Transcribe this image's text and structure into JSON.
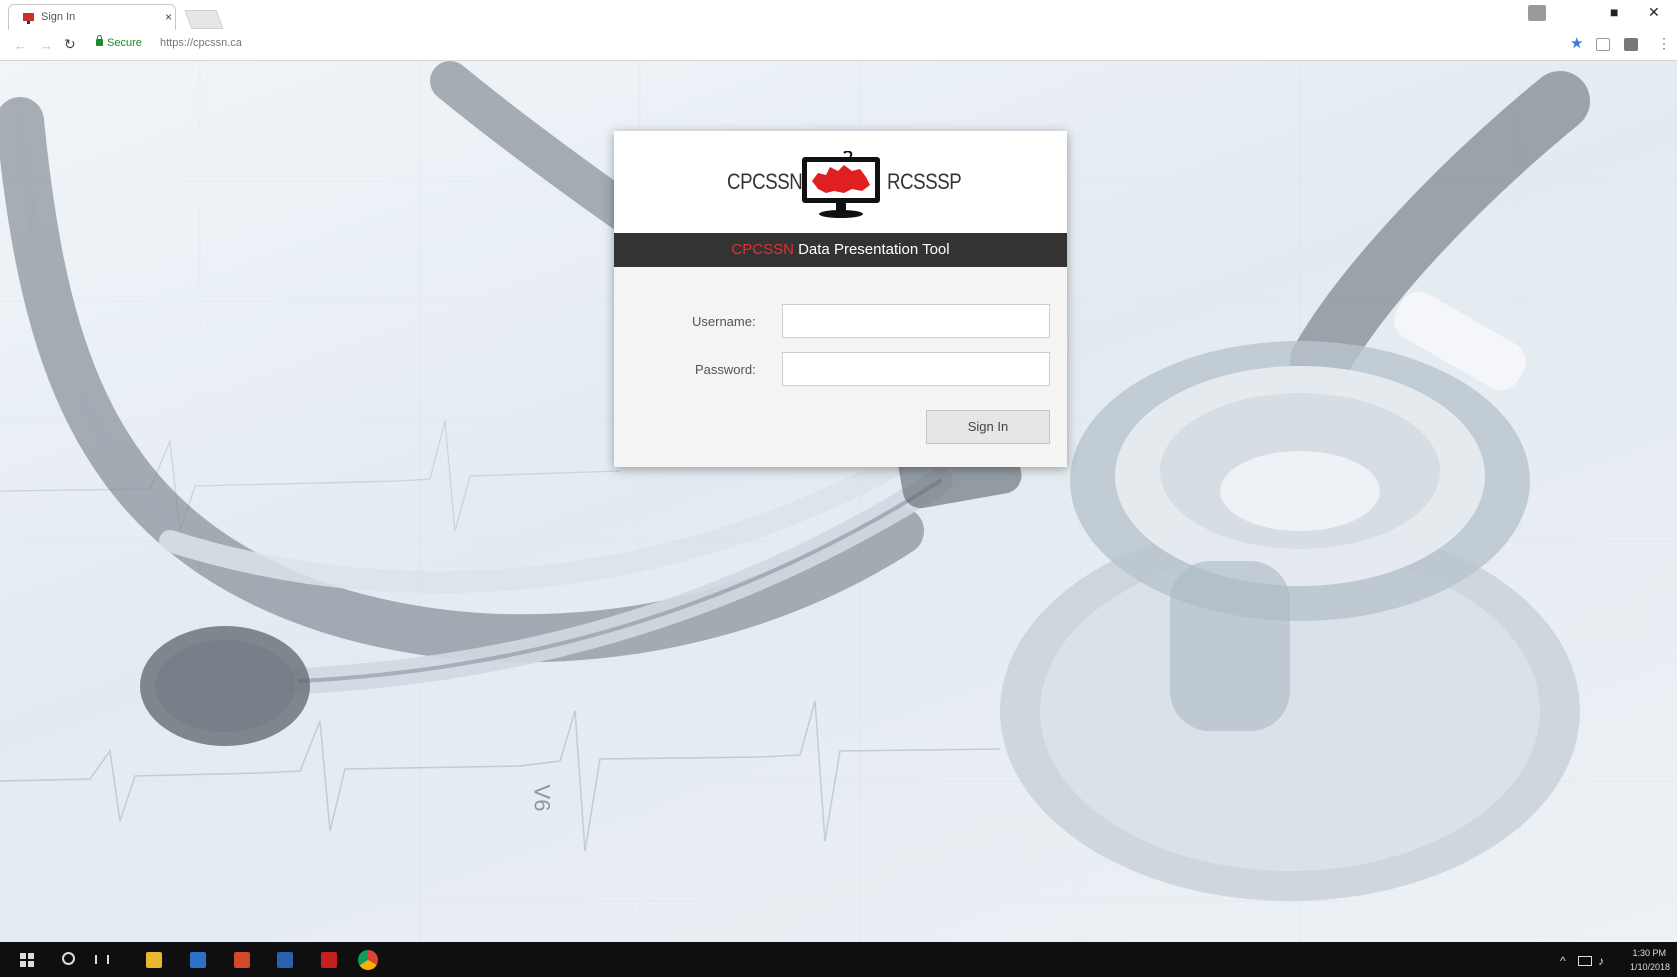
{
  "browser": {
    "tab_title": "Sign In",
    "tab_close": "×",
    "secure_label": "Secure",
    "url": "https://cpcssn.ca",
    "window_buttons": {
      "restore": "■",
      "close": "✕"
    },
    "star_icon": "★",
    "menu_icon": "⋮"
  },
  "login": {
    "logo_left": "CPCSSN",
    "logo_right": "RCSSSP",
    "band_brand": "CPCSSN",
    "band_title": "Data Presentation Tool",
    "username_label": "Username:",
    "password_label": "Password:",
    "username_value": "",
    "password_value": "",
    "signin_label": "Sign In"
  },
  "taskbar": {
    "time": "1:30 PM",
    "date": "1/10/2018"
  },
  "background": {
    "ecg_label": "V6"
  },
  "colors": {
    "brand_red": "#e53030",
    "band_dark": "#333333",
    "secure_green": "#1a8a2a",
    "star_blue": "#3a7bd5"
  }
}
